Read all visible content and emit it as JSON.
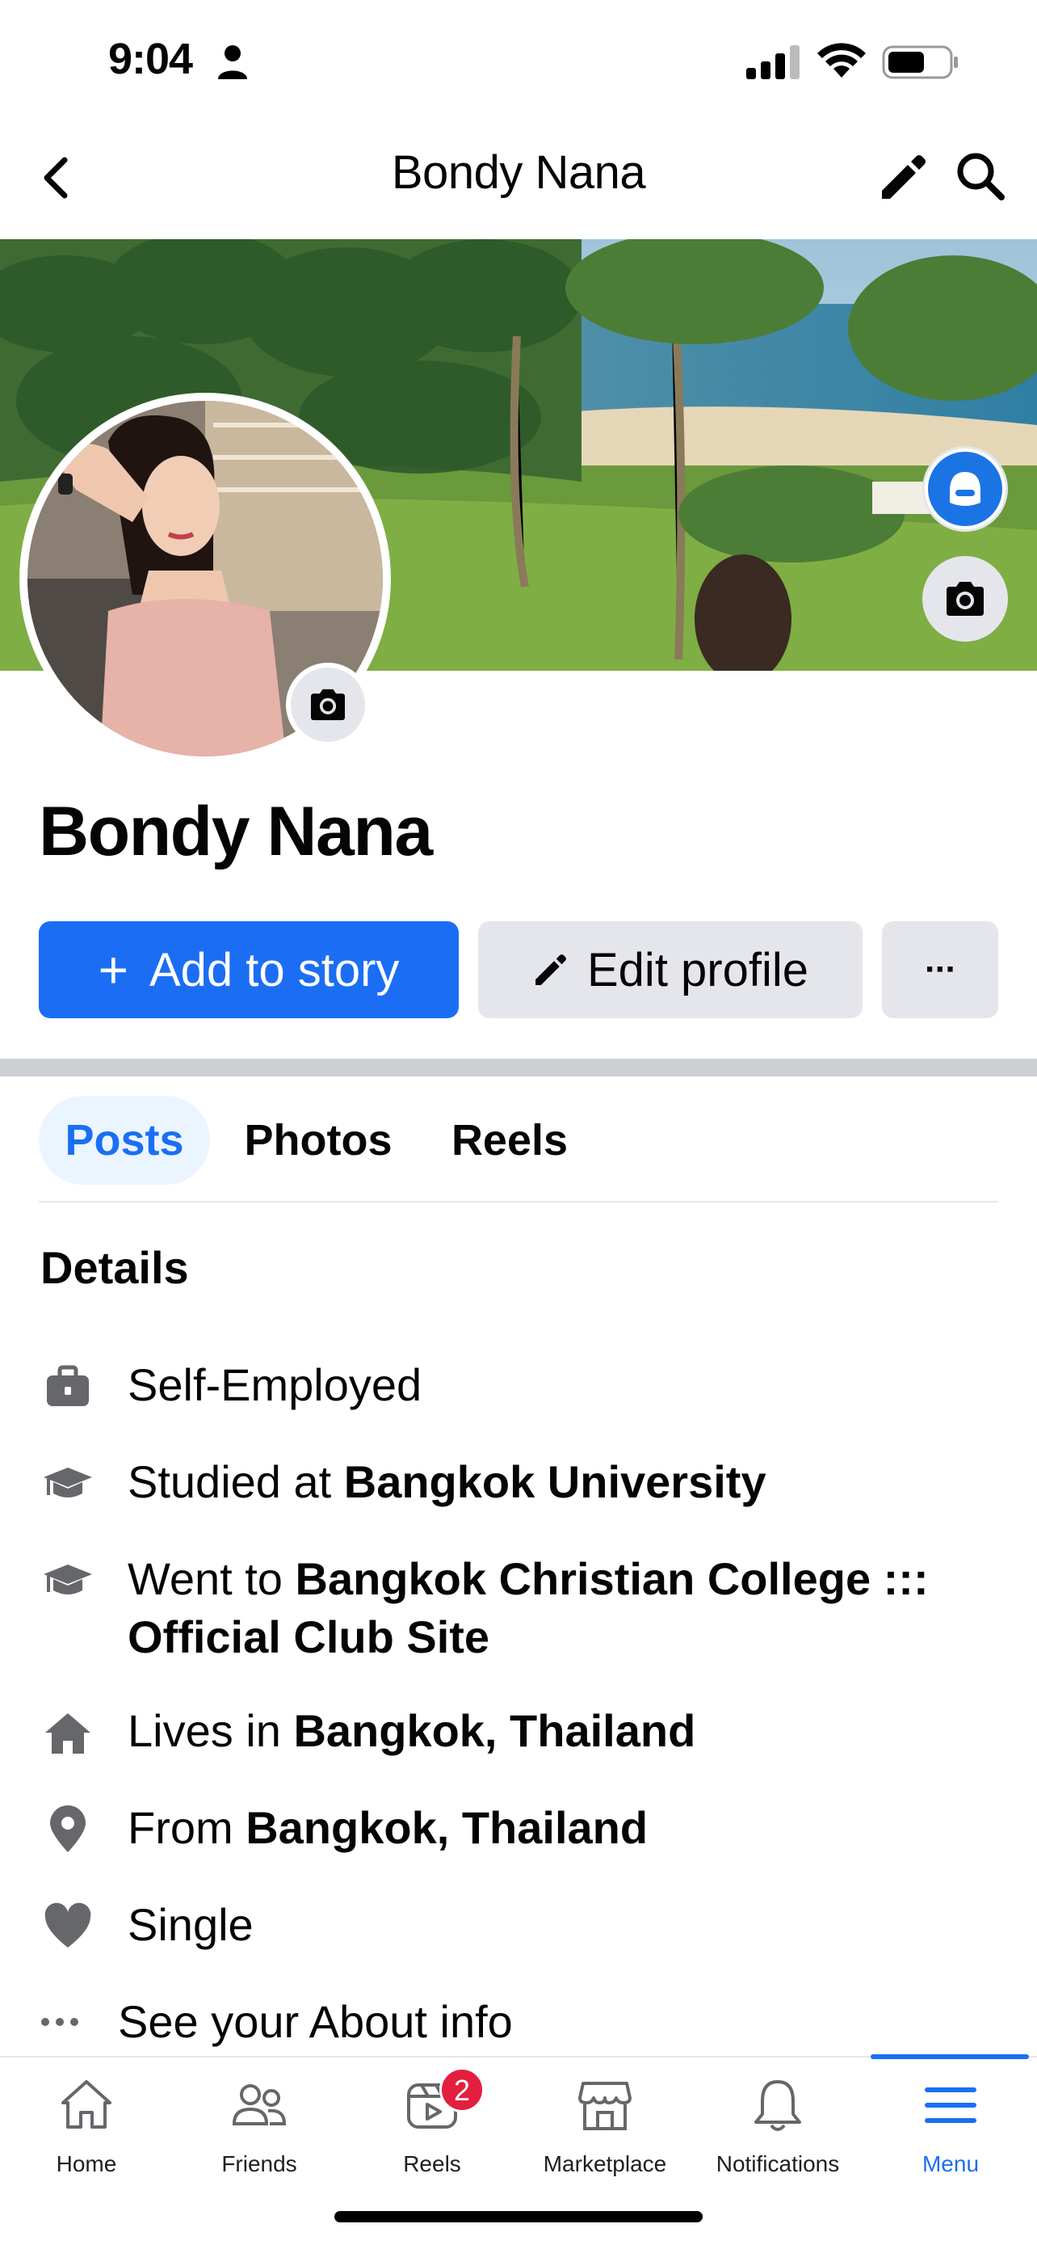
{
  "status_bar": {
    "time": "9:04"
  },
  "header": {
    "title": "Bondy Nana"
  },
  "profile": {
    "name": "Bondy Nana"
  },
  "actions": {
    "add_story_label": "Add to story",
    "add_story_plus": "+",
    "edit_profile_label": "Edit profile",
    "more_label": "···"
  },
  "tabs": [
    {
      "label": "Posts",
      "active": true
    },
    {
      "label": "Photos",
      "active": false
    },
    {
      "label": "Reels",
      "active": false
    }
  ],
  "details": {
    "title": "Details",
    "items": [
      {
        "icon": "briefcase-icon",
        "prefix": "Self-Employed",
        "bold": ""
      },
      {
        "icon": "graduation-cap-icon",
        "prefix": "Studied at ",
        "bold": "Bangkok University"
      },
      {
        "icon": "graduation-cap-icon",
        "prefix": "Went to ",
        "bold": "Bangkok Christian College ::: Official Club Site"
      },
      {
        "icon": "home-icon",
        "prefix": "Lives in ",
        "bold": "Bangkok, Thailand"
      },
      {
        "icon": "location-pin-icon",
        "prefix": "From ",
        "bold": "Bangkok, Thailand"
      },
      {
        "icon": "heart-icon",
        "prefix": "Single",
        "bold": ""
      },
      {
        "icon": "more-dots-icon",
        "prefix": "See your About info",
        "bold": ""
      }
    ]
  },
  "bottom_nav": {
    "items": [
      {
        "label": "Home",
        "icon": "home-icon"
      },
      {
        "label": "Friends",
        "icon": "friends-icon"
      },
      {
        "label": "Reels",
        "icon": "reels-icon",
        "badge": "2"
      },
      {
        "label": "Marketplace",
        "icon": "marketplace-icon"
      },
      {
        "label": "Notifications",
        "icon": "bell-icon"
      },
      {
        "label": "Menu",
        "icon": "menu-icon",
        "active": true
      }
    ]
  },
  "colors": {
    "accent": "#1b6ef3",
    "button_grey": "#e4e6eb",
    "badge_red": "#e41e3f",
    "tab_active_bg": "#ebf5ff"
  }
}
